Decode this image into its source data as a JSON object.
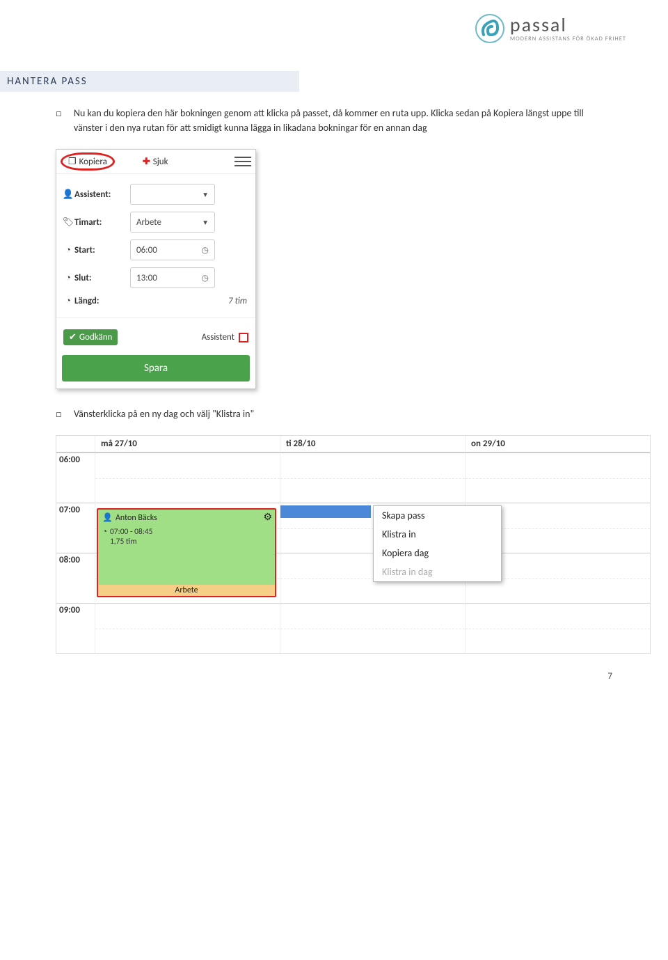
{
  "logo": {
    "name": "passal",
    "tagline": "MODERN ASSISTANS FÖR ÖKAD FRIHET"
  },
  "section_title": "HANTERA PASS",
  "paragraphs": {
    "p1": "Nu kan du kopiera den här bokningen genom att klicka på passet, då kommer en ruta upp. Klicka sedan på Kopiera längst uppe till vänster i den nya rutan för att smidigt kunna lägga in likadana bokningar för en annan dag",
    "p2": "Vänsterklicka på en ny dag och välj \"Klistra in\""
  },
  "panel": {
    "tabs": {
      "kopiera": "Kopiera",
      "sjuk": "Sjuk"
    },
    "rows": {
      "assistent_label": "Assistent:",
      "timart_label": "Timart:",
      "timart_value": "Arbete",
      "start_label": "Start:",
      "start_value": "06:00",
      "slut_label": "Slut:",
      "slut_value": "13:00",
      "langd_label": "Längd:",
      "langd_value": "7 tim"
    },
    "approve": {
      "godkann": "Godkänn",
      "assistent": "Assistent"
    },
    "save": "Spara"
  },
  "calendar": {
    "days": {
      "d1": "må 27/10",
      "d2": "ti 28/10",
      "d3": "on 29/10"
    },
    "hours": {
      "h6": "06:00",
      "h7": "07:00",
      "h8": "08:00",
      "h9": "09:00"
    },
    "event": {
      "name": "Anton Bäcks",
      "time": "07:00 - 08:45",
      "duration": "1,75 tim",
      "category": "Arbete"
    },
    "menu": {
      "skapa": "Skapa pass",
      "klistra": "Klistra in",
      "kopiera_dag": "Kopiera dag",
      "klistra_dag": "Klistra in dag"
    }
  },
  "page_number": "7"
}
